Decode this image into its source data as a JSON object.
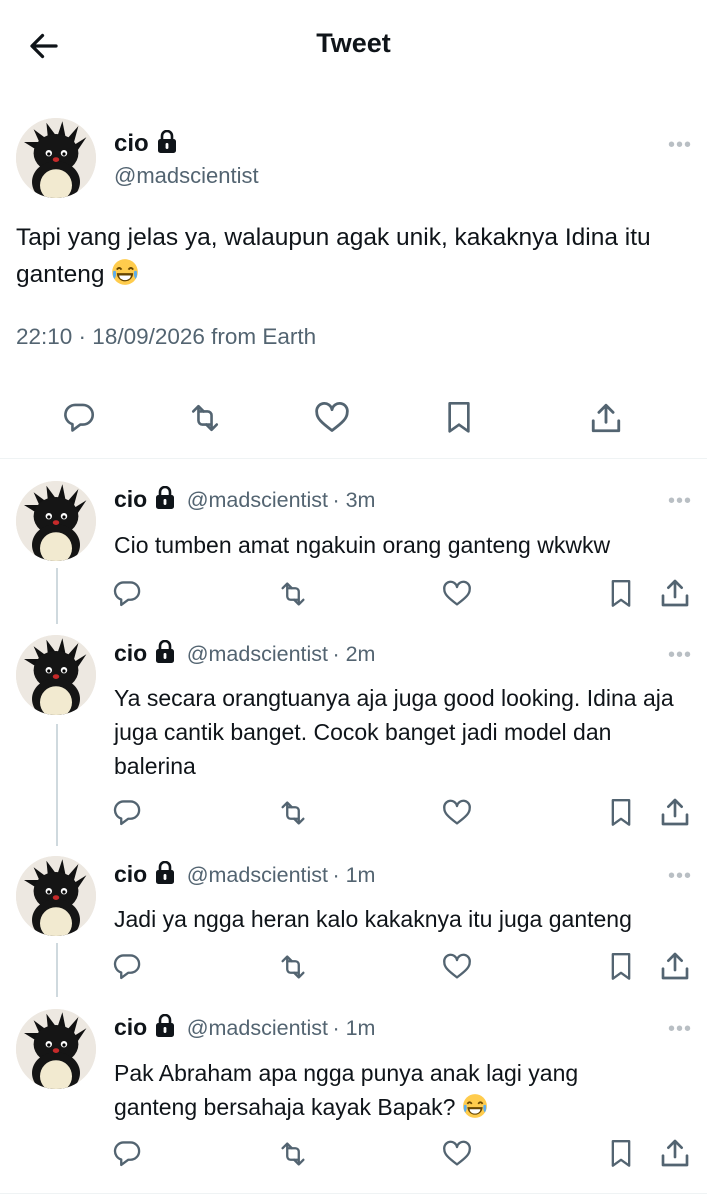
{
  "header": {
    "title": "Tweet",
    "back_icon": "arrow-left-icon"
  },
  "main_tweet": {
    "name": "cio",
    "handle": "@madscientist",
    "text": "Tapi yang jelas ya, walaupun agak unik, kakaknya Idina itu ganteng",
    "emoji": "😂",
    "meta": "22:10 · 18/09/2026 from Earth",
    "actions": [
      "reply-icon",
      "retweet-icon",
      "like-icon",
      "bookmark-icon",
      "share-icon"
    ]
  },
  "replies": [
    {
      "name": "cio",
      "handle": "@madscientist",
      "time": "· 3m",
      "text": "Cio tumben amat ngakuin orang ganteng wkwkw"
    },
    {
      "name": "cio",
      "handle": "@madscientist",
      "time": "· 2m",
      "text": "Ya secara orangtuanya aja juga good looking. Idina aja juga cantik banget. Cocok banget jadi model dan balerina"
    },
    {
      "name": "cio",
      "handle": "@madscientist",
      "time": "· 1m",
      "text": "Jadi ya ngga heran kalo kakaknya itu juga ganteng"
    },
    {
      "name": "cio",
      "handle": "@madscientist",
      "time": "· 1m",
      "text": "Pak Abraham apa ngga punya anak lagi yang ganteng bersahaja kayak Bapak?",
      "emoji": "😂"
    }
  ],
  "more_label": "•••",
  "colors": {
    "text": "#0f1419",
    "secondary": "#536471",
    "divider": "#eff3f4",
    "thread": "#cfd9de"
  }
}
